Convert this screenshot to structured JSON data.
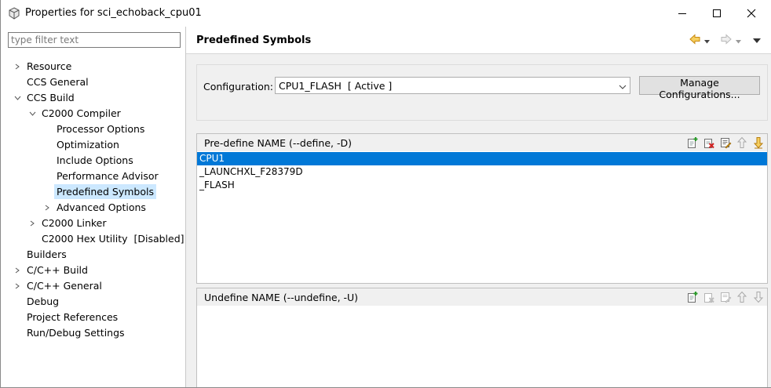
{
  "window": {
    "title": "Properties for sci_echoback_cpu01"
  },
  "filter": {
    "placeholder": "type filter text",
    "value": ""
  },
  "tree": {
    "resource": "Resource",
    "ccs_general": "CCS General",
    "ccs_build": "CCS Build",
    "c2000_compiler": "C2000 Compiler",
    "processor_options": "Processor Options",
    "optimization": "Optimization",
    "include_options": "Include Options",
    "performance_advisor": "Performance Advisor",
    "predefined_symbols": "Predefined Symbols",
    "advanced_options": "Advanced Options",
    "c2000_linker": "C2000 Linker",
    "c2000_hex_utility": "C2000 Hex Utility  [Disabled]",
    "builders": "Builders",
    "cpp_build": "C/C++ Build",
    "cpp_general": "C/C++ General",
    "debug": "Debug",
    "project_references": "Project References",
    "run_debug_settings": "Run/Debug Settings"
  },
  "page": {
    "title": "Predefined Symbols"
  },
  "configuration": {
    "label": "Configuration:",
    "selected": "CPU1_FLASH  [ Active ]",
    "manage_button": "Manage Configurations..."
  },
  "define_panel": {
    "title": "Pre-define NAME (--define, -D)",
    "items": [
      "CPU1",
      "_LAUNCHXL_F28379D",
      "_FLASH"
    ],
    "selected_index": 0
  },
  "undefine_panel": {
    "title": "Undefine NAME (--undefine, -U)",
    "items": []
  },
  "icons": {
    "app": "properties-icon",
    "nav_back": "back-arrow-icon",
    "nav_forward": "forward-arrow-icon",
    "menu": "view-menu-icon",
    "tools": [
      "add-icon",
      "delete-icon",
      "edit-icon",
      "move-up-icon",
      "move-down-icon"
    ]
  },
  "colors": {
    "selection": "#0078d7",
    "tree_selection": "#cce8ff",
    "nav_arrow": "#e6a21b"
  }
}
